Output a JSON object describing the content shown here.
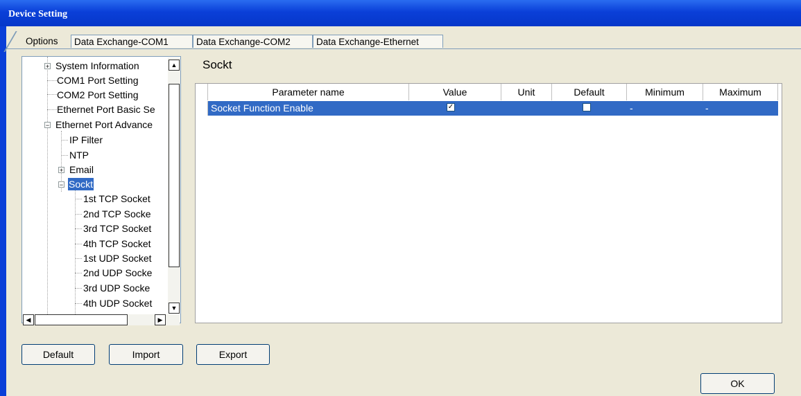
{
  "window": {
    "title": "Device Setting"
  },
  "tabs": [
    {
      "label": "Options"
    },
    {
      "label": "Data Exchange-COM1"
    },
    {
      "label": "Data Exchange-COM2"
    },
    {
      "label": "Data Exchange-Ethernet"
    }
  ],
  "tree": {
    "items": [
      {
        "label": "System Information"
      },
      {
        "label": "COM1 Port Setting"
      },
      {
        "label": "COM2 Port Setting"
      },
      {
        "label": "Ethernet Port Basic Se"
      },
      {
        "label": "Ethernet Port Advance"
      },
      {
        "label": "IP Filter"
      },
      {
        "label": "NTP"
      },
      {
        "label": "Email"
      },
      {
        "label": "Sockt"
      },
      {
        "label": "1st TCP Socket"
      },
      {
        "label": "2nd TCP Socke"
      },
      {
        "label": "3rd TCP Socket"
      },
      {
        "label": "4th TCP Socket"
      },
      {
        "label": "1st UDP Socket"
      },
      {
        "label": "2nd UDP Socke"
      },
      {
        "label": "3rd UDP Socke"
      },
      {
        "label": "4th UDP Socket"
      }
    ]
  },
  "section": {
    "title": "Sockt"
  },
  "grid": {
    "columns": [
      "Parameter name",
      "Value",
      "Unit",
      "Default",
      "Minimum",
      "Maximum"
    ],
    "rows": [
      {
        "name": "Socket Function Enable",
        "value_checked": true,
        "unit": "",
        "default_checked": false,
        "minimum": "-",
        "maximum": "-"
      }
    ]
  },
  "buttons": {
    "default": "Default",
    "import": "Import",
    "export": "Export",
    "ok": "OK"
  },
  "colors": {
    "titlebar": "#0a3fd8",
    "selection": "#316ac5",
    "dialog_bg": "#ece9d8"
  }
}
